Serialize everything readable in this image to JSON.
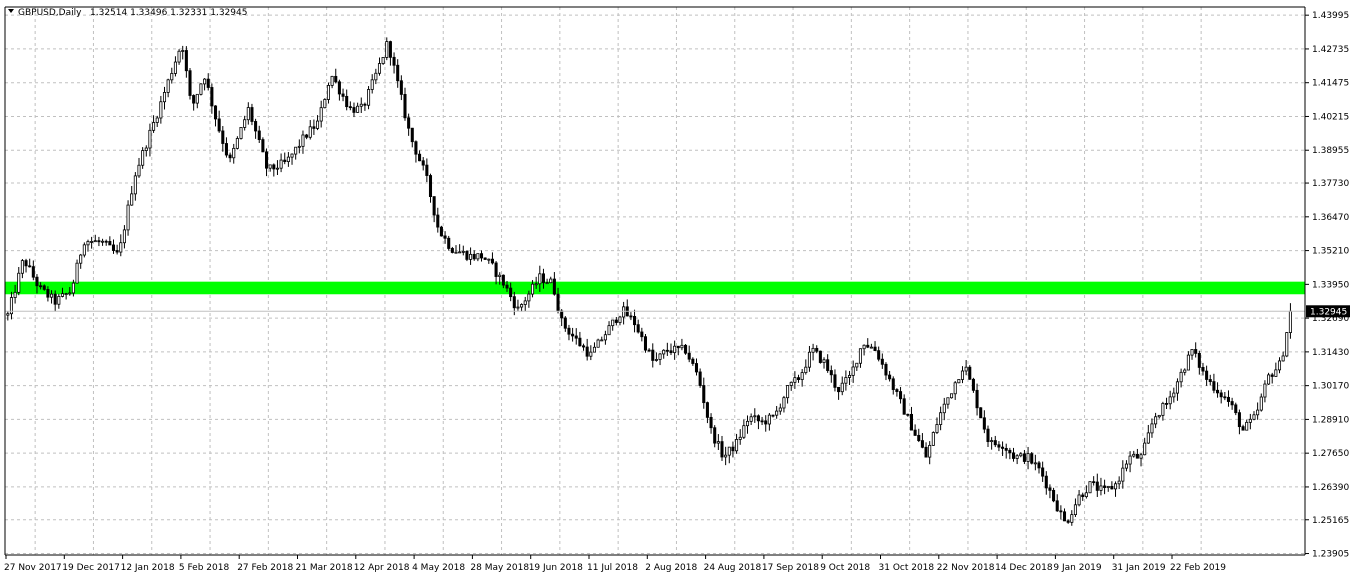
{
  "header": {
    "symbol": "GBPUSD,Daily",
    "ohlc": "1.32514 1.33496 1.32331 1.32945"
  },
  "colors": {
    "background": "#ffffff",
    "grid": "#c0c0c0",
    "candle_bull": "#ffffff",
    "candle_bear": "#000000",
    "candle_outline": "#000000",
    "zone": "#00ff00",
    "price_badge_bg": "#000000",
    "price_badge_text": "#ffffff",
    "price_line": "#c0c0c0"
  },
  "chart_data": {
    "type": "candlestick",
    "title": "GBPUSD,Daily",
    "ohlc_text": "1.32514 1.33496 1.32331 1.32945",
    "ylim": [
      1.2385,
      1.443
    ],
    "y_ticks": [
      "1.43995",
      "1.42735",
      "1.41475",
      "1.40215",
      "1.38955",
      "1.37730",
      "1.36470",
      "1.35210",
      "1.33950",
      "1.32690",
      "1.31430",
      "1.30170",
      "1.28910",
      "1.27650",
      "1.26390",
      "1.25165",
      "1.23905"
    ],
    "x_ticks": [
      "27 Nov 2017",
      "19 Dec 2017",
      "12 Jan 2018",
      "5 Feb 2018",
      "27 Feb 2018",
      "21 Mar 2018",
      "12 Apr 2018",
      "4 May 2018",
      "28 May 2018",
      "19 Jun 2018",
      "11 Jul 2018",
      "2 Aug 2018",
      "24 Aug 2018",
      "17 Sep 2018",
      "9 Oct 2018",
      "31 Oct 2018",
      "22 Nov 2018",
      "14 Dec 2018",
      "9 Jan 2019",
      "31 Jan 2019",
      "22 Feb 2019"
    ],
    "bars_per_tick": 16,
    "total_bars": 328,
    "grid": true,
    "current_price": {
      "label": "1.32945",
      "value": 1.32945
    },
    "zone": {
      "low": 1.3358,
      "high": 1.3405
    },
    "price_path": [
      [
        0,
        1.328
      ],
      [
        5,
        1.349
      ],
      [
        10,
        1.338
      ],
      [
        15,
        1.333
      ],
      [
        20,
        1.337
      ],
      [
        24,
        1.356
      ],
      [
        30,
        1.355
      ],
      [
        35,
        1.35
      ],
      [
        40,
        1.38
      ],
      [
        44,
        1.393
      ],
      [
        48,
        1.406
      ],
      [
        52,
        1.42
      ],
      [
        55,
        1.43
      ],
      [
        58,
        1.405
      ],
      [
        62,
        1.418
      ],
      [
        66,
        1.4
      ],
      [
        70,
        1.385
      ],
      [
        76,
        1.405
      ],
      [
        82,
        1.382
      ],
      [
        88,
        1.385
      ],
      [
        94,
        1.395
      ],
      [
        98,
        1.4
      ],
      [
        102,
        1.418
      ],
      [
        108,
        1.405
      ],
      [
        112,
        1.405
      ],
      [
        117,
        1.42
      ],
      [
        120,
        1.43
      ],
      [
        123,
        1.415
      ],
      [
        127,
        1.395
      ],
      [
        132,
        1.38
      ],
      [
        136,
        1.36
      ],
      [
        140,
        1.353
      ],
      [
        146,
        1.35
      ],
      [
        150,
        1.35
      ],
      [
        153,
        1.346
      ],
      [
        157,
        1.339
      ],
      [
        161,
        1.33
      ],
      [
        164,
        1.335
      ],
      [
        168,
        1.342
      ],
      [
        172,
        1.34
      ],
      [
        175,
        1.325
      ],
      [
        180,
        1.318
      ],
      [
        184,
        1.313
      ],
      [
        188,
        1.32
      ],
      [
        194,
        1.33
      ],
      [
        198,
        1.325
      ],
      [
        204,
        1.31
      ],
      [
        208,
        1.315
      ],
      [
        214,
        1.315
      ],
      [
        218,
        1.305
      ],
      [
        222,
        1.285
      ],
      [
        226,
        1.275
      ],
      [
        230,
        1.28
      ],
      [
        234,
        1.29
      ],
      [
        238,
        1.288
      ],
      [
        242,
        1.29
      ],
      [
        246,
        1.3
      ],
      [
        250,
        1.305
      ],
      [
        254,
        1.315
      ],
      [
        258,
        1.31
      ],
      [
        262,
        1.3
      ],
      [
        266,
        1.305
      ],
      [
        270,
        1.318
      ],
      [
        274,
        1.315
      ],
      [
        278,
        1.305
      ],
      [
        282,
        1.295
      ],
      [
        286,
        1.285
      ],
      [
        290,
        1.275
      ],
      [
        294,
        1.29
      ],
      [
        298,
        1.3
      ],
      [
        302,
        1.31
      ],
      [
        306,
        1.295
      ],
      [
        310,
        1.28
      ],
      [
        314,
        1.28
      ],
      [
        318,
        1.275
      ],
      [
        322,
        1.275
      ],
      [
        326,
        1.27
      ],
      [
        330,
        1.26
      ],
      [
        334,
        1.25
      ],
      [
        338,
        1.26
      ],
      [
        342,
        1.265
      ],
      [
        346,
        1.262
      ],
      [
        350,
        1.265
      ],
      [
        354,
        1.275
      ],
      [
        358,
        1.275
      ],
      [
        362,
        1.29
      ],
      [
        366,
        1.295
      ],
      [
        370,
        1.305
      ],
      [
        374,
        1.315
      ],
      [
        378,
        1.305
      ],
      [
        382,
        1.3
      ],
      [
        386,
        1.295
      ],
      [
        390,
        1.285
      ],
      [
        394,
        1.29
      ],
      [
        398,
        1.305
      ],
      [
        402,
        1.31
      ],
      [
        405,
        1.3294
      ]
    ]
  }
}
